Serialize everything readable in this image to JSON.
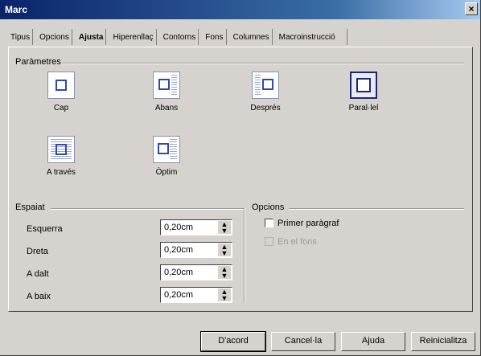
{
  "window": {
    "title": "Marc",
    "close_glyph": "×"
  },
  "tabs": [
    "Tipus",
    "Opcions",
    "Ajusta",
    "Hiperenllaç",
    "Contorns",
    "Fons",
    "Columnes",
    "Macroinstrucció"
  ],
  "parameters": {
    "label": "Paràmetres",
    "options": [
      {
        "label": "Cap",
        "icon": "wrap-none-icon",
        "selected": false
      },
      {
        "label": "Abans",
        "icon": "wrap-before-icon",
        "selected": false
      },
      {
        "label": "Després",
        "icon": "wrap-after-icon",
        "selected": false
      },
      {
        "label": "Paral·lel",
        "icon": "wrap-parallel-icon",
        "selected": true
      },
      {
        "label": "A través",
        "icon": "wrap-through-icon",
        "selected": false
      },
      {
        "label": "Òptim",
        "icon": "wrap-optimal-icon",
        "selected": false
      }
    ]
  },
  "spacing": {
    "label": "Espaiat",
    "fields": [
      {
        "label": "Esquerra",
        "value": "0,20cm"
      },
      {
        "label": "Dreta",
        "value": "0,20cm"
      },
      {
        "label": "A dalt",
        "value": "0,20cm"
      },
      {
        "label": "A baix",
        "value": "0,20cm"
      }
    ],
    "spin_up": "▲",
    "spin_down": "▼"
  },
  "options": {
    "label": "Opcions",
    "first_paragraph": {
      "label": "Primer paràgraf",
      "checked": false
    },
    "in_background": {
      "label": "En el fons",
      "checked": false,
      "disabled": true
    }
  },
  "buttons": {
    "ok": "D'acord",
    "cancel": "Cancel·la",
    "help": "Ajuda",
    "reset": "Reinicialitza"
  }
}
